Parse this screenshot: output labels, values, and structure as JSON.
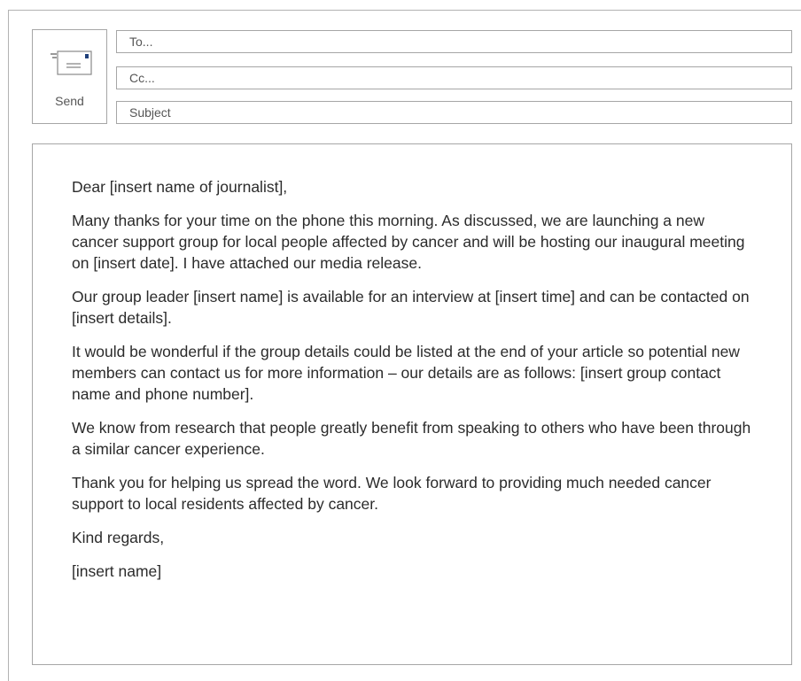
{
  "compose": {
    "send_label": "Send",
    "to_placeholder": "To...",
    "cc_placeholder": "Cc...",
    "subject_placeholder": "Subject",
    "send_icon": "envelope-send-icon"
  },
  "message": {
    "greeting": "Dear [insert name of journalist],",
    "paragraphs": [
      "Many thanks for your time on the phone this morning. As discussed, we are launching a new cancer support group for local people affected by cancer and will be hosting our inaugural meeting on [insert date]. I have attached our media release.",
      "Our group leader [insert name] is available for an interview at [insert time] and can be contacted on [insert details].",
      "It would be wonderful if the group details could be listed at the end of your article so potential new members can contact us for more information – our details are as follows: [insert group contact name and phone number].",
      "We know from research that people greatly benefit from speaking to others who have been through a similar cancer experience.",
      "Thank you for helping us spread the word. We look forward to providing much needed cancer support to local residents affected by cancer."
    ],
    "signoff": "Kind regards,",
    "signature": "[insert name]"
  },
  "colors": {
    "border": "#a6a6a6",
    "text": "#2b2b2b",
    "stamp": "#1f3f7a"
  }
}
